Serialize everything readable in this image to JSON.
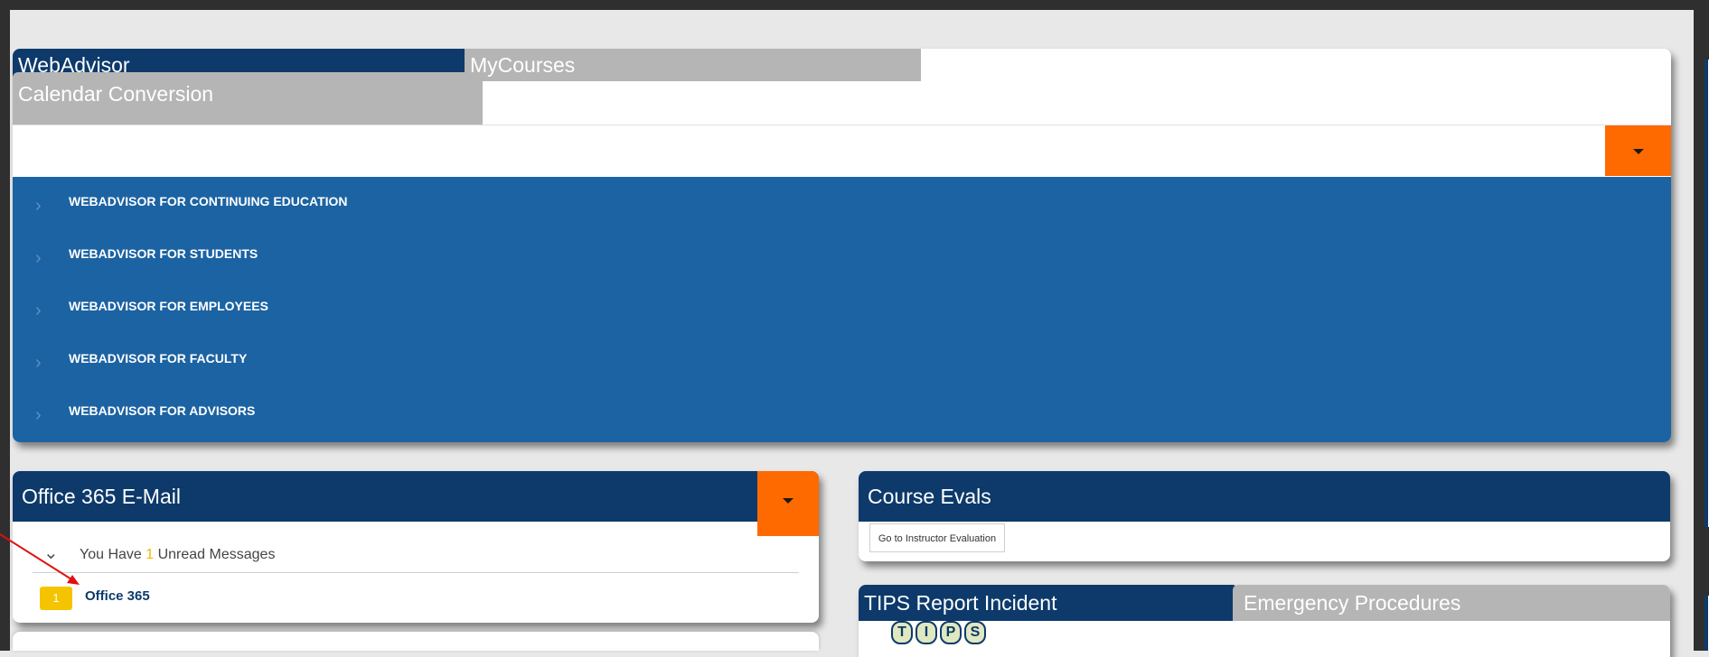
{
  "webadvisor_panel": {
    "tabs": [
      {
        "label": "WebAdvisor",
        "active": true
      },
      {
        "label": "MyCourses",
        "active": false
      },
      {
        "label": "Calendar Conversion",
        "active": false
      }
    ],
    "menu_items": [
      "WEBADVISOR FOR CONTINUING EDUCATION",
      "WEBADVISOR FOR STUDENTS",
      "WEBADVISOR FOR EMPLOYEES",
      "WEBADVISOR FOR FACULTY",
      "WEBADVISOR FOR ADVISORS"
    ]
  },
  "office365_panel": {
    "title": "Office 365 E-Mail",
    "unread_prefix": "You Have ",
    "unread_count": "1",
    "unread_suffix": " Unread Messages",
    "badge": "1",
    "link_label": "Office 365"
  },
  "course_evals_panel": {
    "title": "Course Evals",
    "button_label": "Go to Instructor Evaluation"
  },
  "tips_panel": {
    "tabs": [
      {
        "label": "TIPS Report Incident",
        "active": true
      },
      {
        "label": "Emergency Procedures",
        "active": false
      }
    ],
    "logo_letters": [
      "T",
      "I",
      "P",
      "S"
    ]
  },
  "colors": {
    "navy": "#0d3a6b",
    "menu_blue": "#1c63a3",
    "orange": "#ff6a00",
    "badge_yellow": "#f5c400",
    "annotation_red": "#e01010"
  }
}
